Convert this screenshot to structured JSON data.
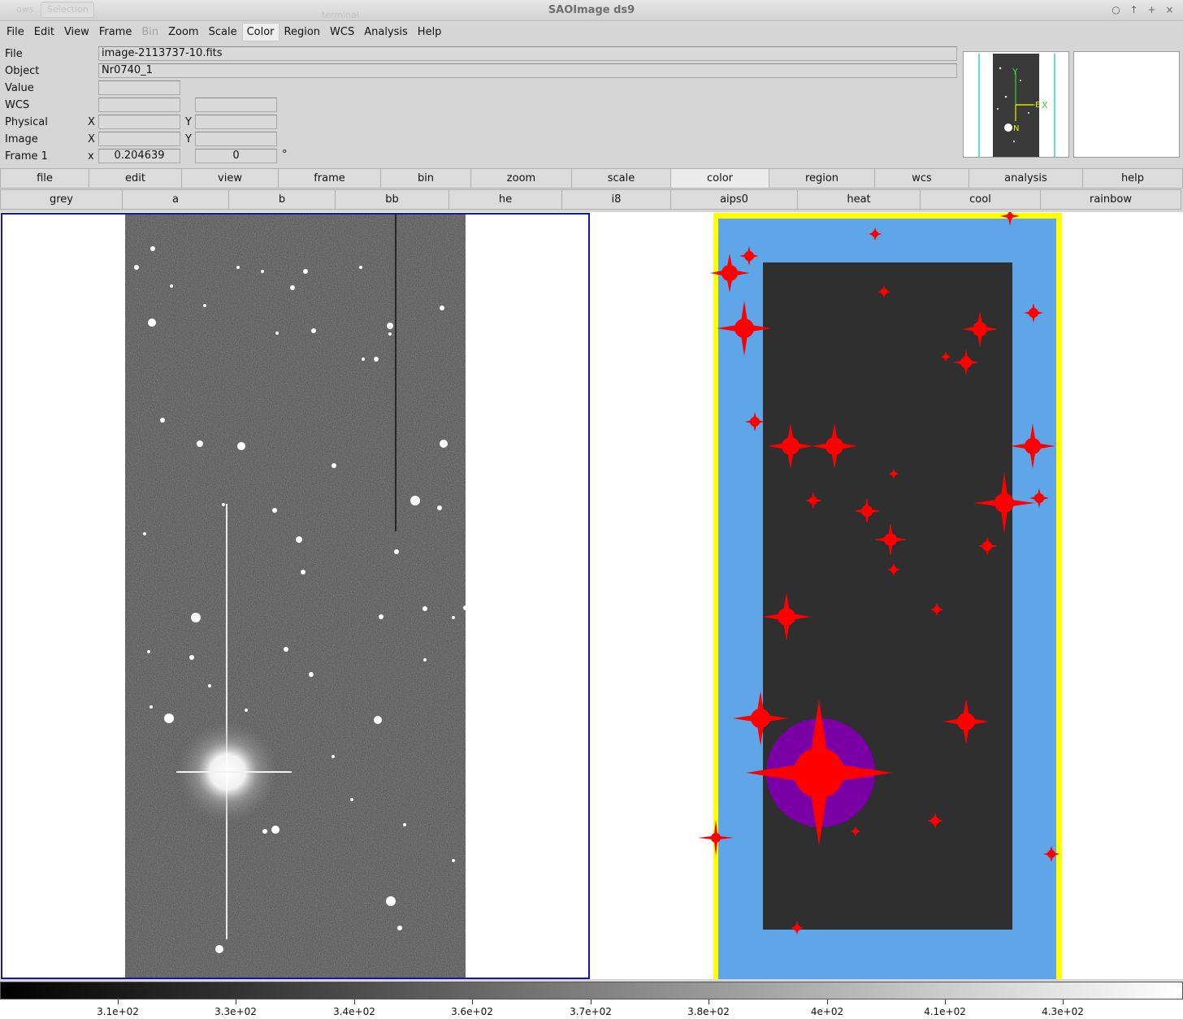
{
  "window": {
    "title": "SAOImage ds9",
    "ghost_tab_1": "ows",
    "ghost_tab_2": "Selection",
    "ghost_text": "terminal",
    "controls": [
      "○",
      "↑",
      "+",
      "×"
    ]
  },
  "menubar": {
    "items": [
      {
        "label": "File"
      },
      {
        "label": "Edit"
      },
      {
        "label": "View"
      },
      {
        "label": "Frame"
      },
      {
        "label": "Bin",
        "disabled": true
      },
      {
        "label": "Zoom"
      },
      {
        "label": "Scale"
      },
      {
        "label": "Color",
        "active": true
      },
      {
        "label": "Region"
      },
      {
        "label": "WCS"
      },
      {
        "label": "Analysis"
      },
      {
        "label": "Help"
      }
    ]
  },
  "info": {
    "file_label": "File",
    "file_value": "image-2113737-10.fits",
    "object_label": "Object",
    "object_value": "Nr0740_1",
    "value_label": "Value",
    "value_value": "",
    "wcs_label": "WCS",
    "wcs_value_1": "",
    "wcs_value_2": "",
    "physical_label": "Physical",
    "physical_x_label": "X",
    "physical_x": "",
    "physical_y_label": "Y",
    "physical_y": "",
    "image_label": "Image",
    "image_x_label": "X",
    "image_x": "",
    "image_y_label": "Y",
    "image_y": "",
    "frame_label": "Frame 1",
    "frame_x_label": "x",
    "frame_zoom": "0.204639",
    "frame_angle": "0",
    "frame_angle_unit": "°"
  },
  "magnifier": {
    "x_axis": "X",
    "y_axis": "Y",
    "north": "N",
    "east": "E"
  },
  "button_bar": {
    "items": [
      "file",
      "edit",
      "view",
      "frame",
      "bin",
      "zoom",
      "scale",
      "color",
      "region",
      "wcs",
      "analysis",
      "help"
    ],
    "active": "color"
  },
  "colormap_bar": {
    "items": [
      "grey",
      "a",
      "b",
      "bb",
      "he",
      "i8",
      "aips0",
      "heat",
      "cool",
      "rainbow"
    ]
  },
  "colorbar": {
    "ticks": [
      "3.1e+02",
      "3.3e+02",
      "3.4e+02",
      "3.6e+02",
      "3.7e+02",
      "3.8e+02",
      "4e+02",
      "4.1e+02",
      "4.3e+02"
    ]
  },
  "colors": {
    "frame_border": "#1414b4",
    "mask_yellow": "#ffff00",
    "mask_blue": "#5ea6e8",
    "mask_dark": "#2f2f2f",
    "mask_red": "#ff0000",
    "mask_purple": "#7a00a6"
  }
}
